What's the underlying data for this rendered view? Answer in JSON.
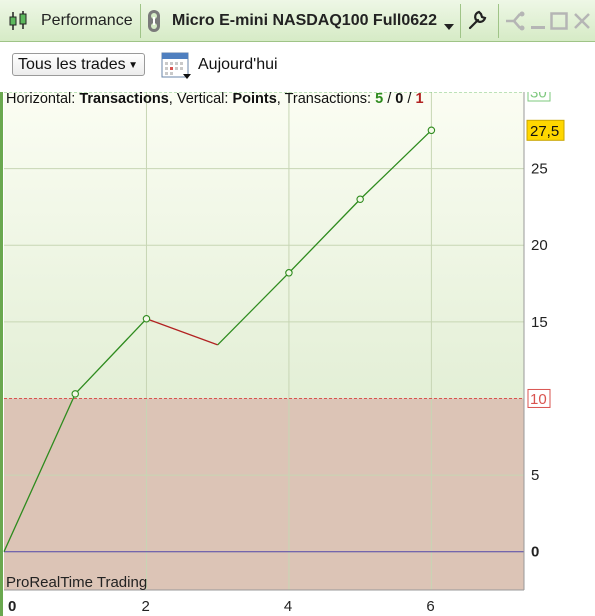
{
  "window": {
    "title": "Performance",
    "instrument": "Micro E-mini NASDAQ100 Full0622"
  },
  "toolbar": {
    "filter_label": "Tous les trades",
    "date_label": "Aujourd'hui"
  },
  "chart_info": {
    "horizontal_label": "Horizontal: ",
    "horizontal_value": "Transactions",
    "vertical_label": ", Vertical: ",
    "vertical_value": "Points",
    "transactions_label": ", Transactions: ",
    "transactions_win": "5",
    "transactions_neutral": "0",
    "transactions_loss": "1",
    "separator": " / "
  },
  "credit": "ProRealTime Trading",
  "colors": {
    "gain_line": "#2e8b1e",
    "loss_line": "#b22222",
    "upper_zone": "#f0f6e2",
    "lower_zone": "#dcc4b6",
    "zero_line": "#5544aa",
    "target_label_bg": "#ffd700",
    "upper_threshold": "#7ec87e",
    "lower_threshold": "#d9534f"
  },
  "chart_data": {
    "type": "line",
    "x": [
      0,
      1,
      2,
      3,
      4,
      5,
      6
    ],
    "y": [
      0,
      10.3,
      15.2,
      13.5,
      18.2,
      23,
      27.5
    ],
    "segment_result": [
      "gain",
      "gain",
      "loss",
      "gain",
      "gain",
      "gain"
    ],
    "xlabel": "",
    "ylabel": "",
    "xlim": [
      0,
      7.3
    ],
    "ylim": [
      -2.5,
      30
    ],
    "x_ticks": [
      "0",
      "2",
      "4",
      "6"
    ],
    "x_tick_values": [
      0,
      2,
      4,
      6
    ],
    "y_ticks": [
      "0",
      "5",
      "15",
      "20",
      "25"
    ],
    "y_tick_values": [
      0,
      5,
      15,
      20,
      25
    ],
    "upper_threshold": {
      "value": 30,
      "label": "30"
    },
    "lower_threshold": {
      "value": 10,
      "label": "10"
    },
    "last_value_label": "27,5",
    "zero_label": "0",
    "x_zero_label": "0",
    "grid": true
  }
}
